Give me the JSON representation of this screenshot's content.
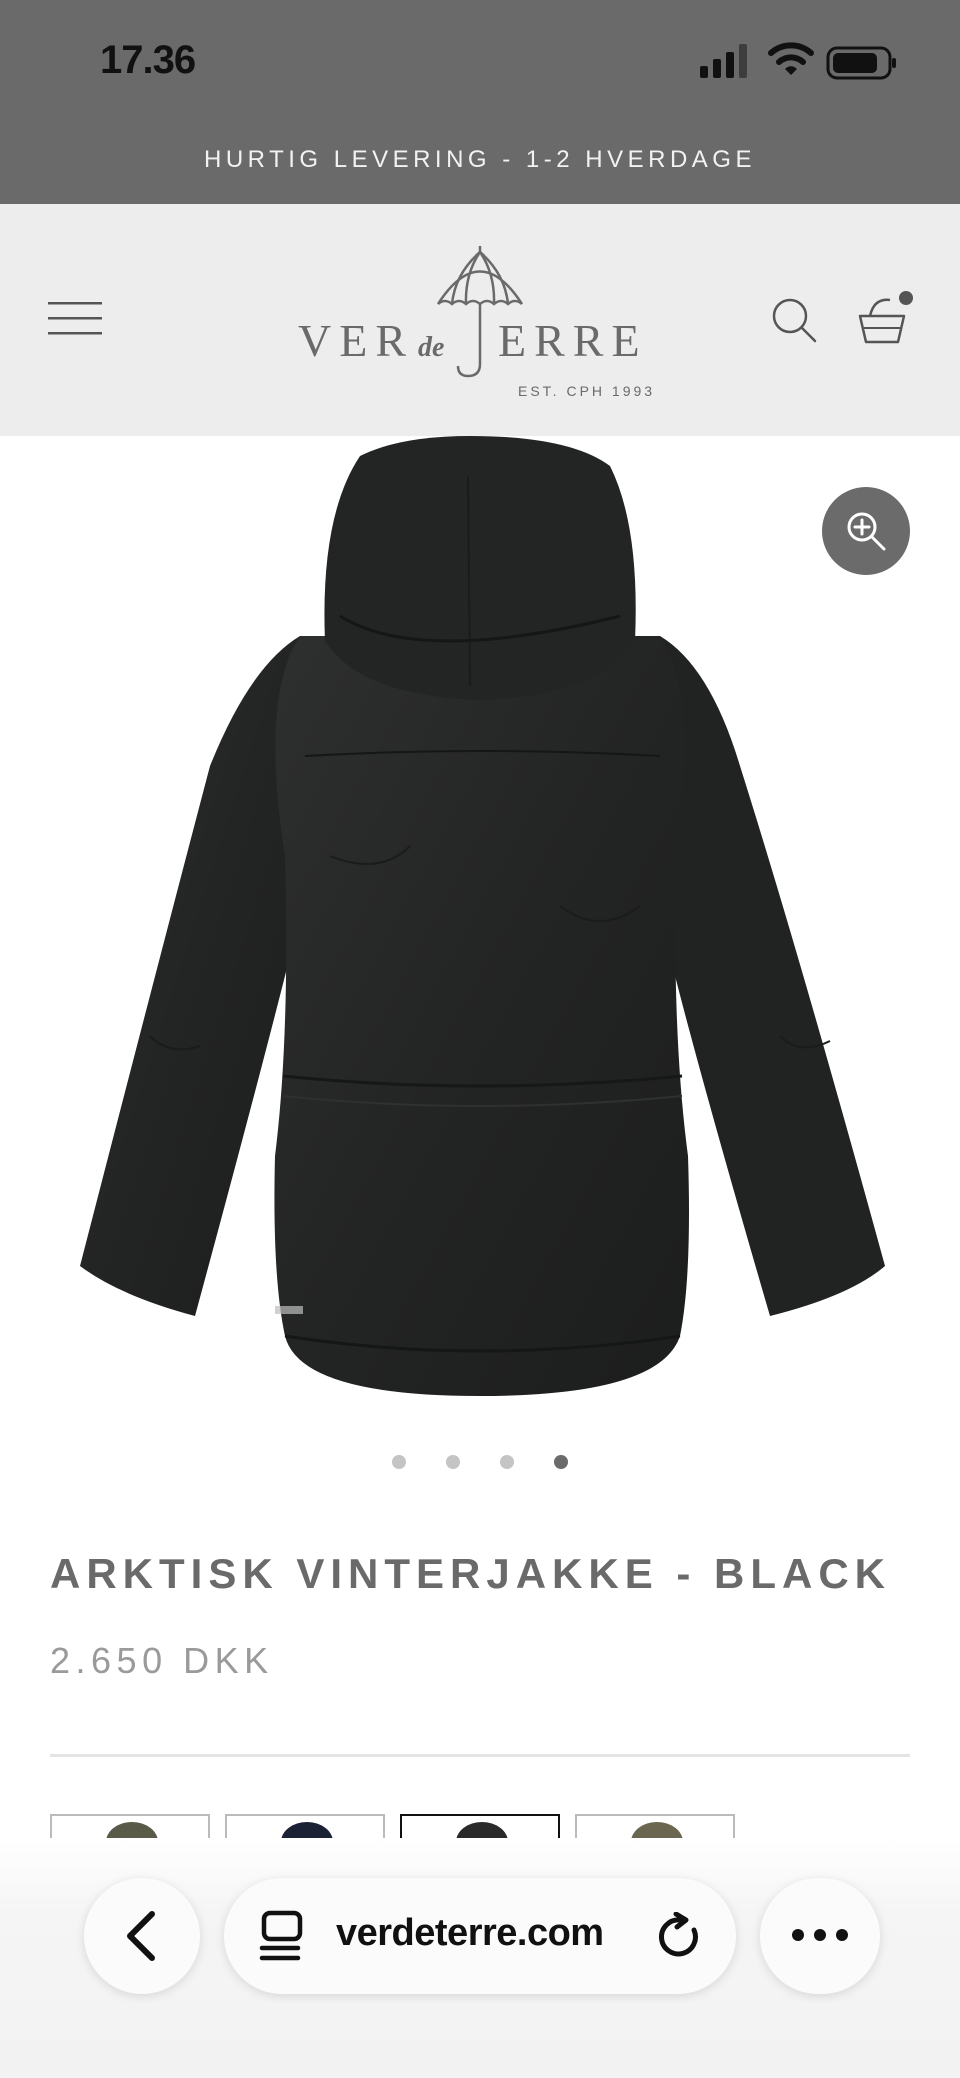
{
  "status_bar": {
    "time": "17.36"
  },
  "announcement": {
    "text": "HURTIG LEVERING - 1-2 HVERDAGE"
  },
  "header": {
    "logo": {
      "word_left": "VER",
      "word_middle": "de",
      "word_right": "ERRE",
      "tagline": "EST. CPH 1993"
    },
    "icons": [
      "menu-icon",
      "search-icon",
      "basket-icon"
    ],
    "basket_has_items": true
  },
  "product": {
    "title": "ARKTISK VINTERJAKKE - BLACK",
    "price": "2.650 DKK",
    "image_count": 4,
    "active_image": 4,
    "swatches": [
      {
        "color": "#5a5a48",
        "selected": false
      },
      {
        "color": "#1c2236",
        "selected": false
      },
      {
        "color": "#2a2a2a",
        "selected": true
      },
      {
        "color": "#6a6650",
        "selected": false
      }
    ]
  },
  "browser": {
    "url": "verdeterre.com",
    "icons": [
      "back-icon",
      "tabs-icon",
      "reload-icon",
      "more-icon"
    ]
  },
  "colors": {
    "bar_gray": "#6a6a6a",
    "header_bg": "#ededed",
    "jacket": "#262727",
    "title_gray": "#6a6a6a",
    "price_gray": "#9a9a9a"
  }
}
